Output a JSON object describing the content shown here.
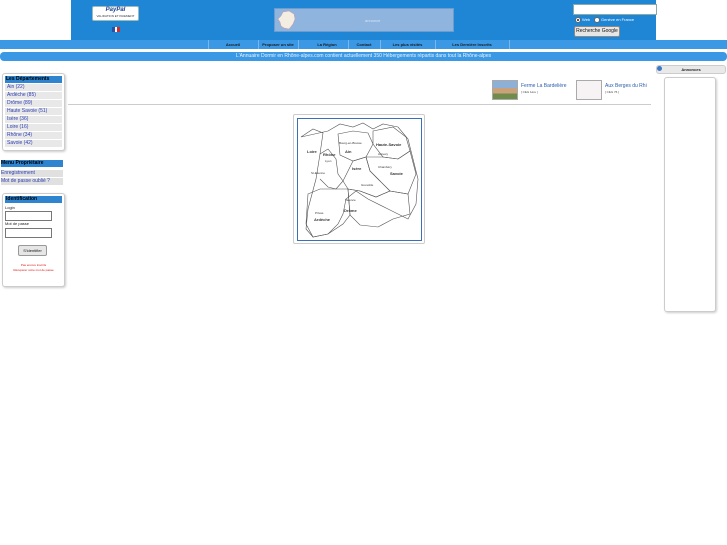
{
  "header": {
    "paypal": {
      "logo": "PayPal",
      "sub": "VALIDATION ET PAIEMENT"
    },
    "flag_colors": [
      "#2b4ea0",
      "#ffffff",
      "#d22b2b"
    ],
    "banner_text": "annonce",
    "search": {
      "value": "",
      "radio_web": "Web",
      "radio_site": "Genève en France",
      "button": "Recherche Google"
    }
  },
  "nav": {
    "items": [
      "Accueil",
      "Proposer un site",
      "La Région",
      "Contact",
      "Les plus visités",
      "Les Dernière Inscrits"
    ]
  },
  "info_bar": "L'Annuaire Dormir en Rhône-alpes.com contient actuellement 350 Hébergements répartis dans tout la Rhône-alpes",
  "departements": {
    "title": "Les Départements",
    "items": [
      "Ain (22)",
      "Ardèche (85)",
      "Drôme (89)",
      "Haute Savoie (51)",
      "Isère (36)",
      "Loire (16)",
      "Rhône (34)",
      "Savoie (42)"
    ]
  },
  "menu": {
    "title": "Menu Propriétaire",
    "items": [
      "Enregistrement",
      "Mot de passe oublié ?"
    ]
  },
  "login": {
    "title": "Identification",
    "login_label": "Login",
    "password_label": "Mot de passe",
    "button": "S'identifier",
    "note1": "Pas encore inscrits",
    "note2": "Récupérer votre mot de passe"
  },
  "listings": [
    {
      "title": "Ferme La Bardelière",
      "clicks": "[ Click 1ère ]"
    },
    {
      "title": "Aux Berges du Rhi",
      "clicks": "[ Click 76 ]"
    }
  ],
  "map": {
    "labels": [
      "Ain",
      "Rhône",
      "Loire",
      "Isère",
      "Savoie",
      "Haute-Savoie",
      "Drôme",
      "Ardèche"
    ],
    "cities": [
      "Bourg-en-Bresse",
      "Lyon",
      "St-Etienne",
      "Chambéry",
      "Annecy",
      "Grenoble",
      "Valence",
      "Privas"
    ]
  },
  "ads": {
    "title": "Annonces"
  },
  "colors": {
    "header": "#1f86d6",
    "nav": "#3a98e4",
    "section_title": "#2f84d0",
    "link": "#2a3bb0"
  }
}
